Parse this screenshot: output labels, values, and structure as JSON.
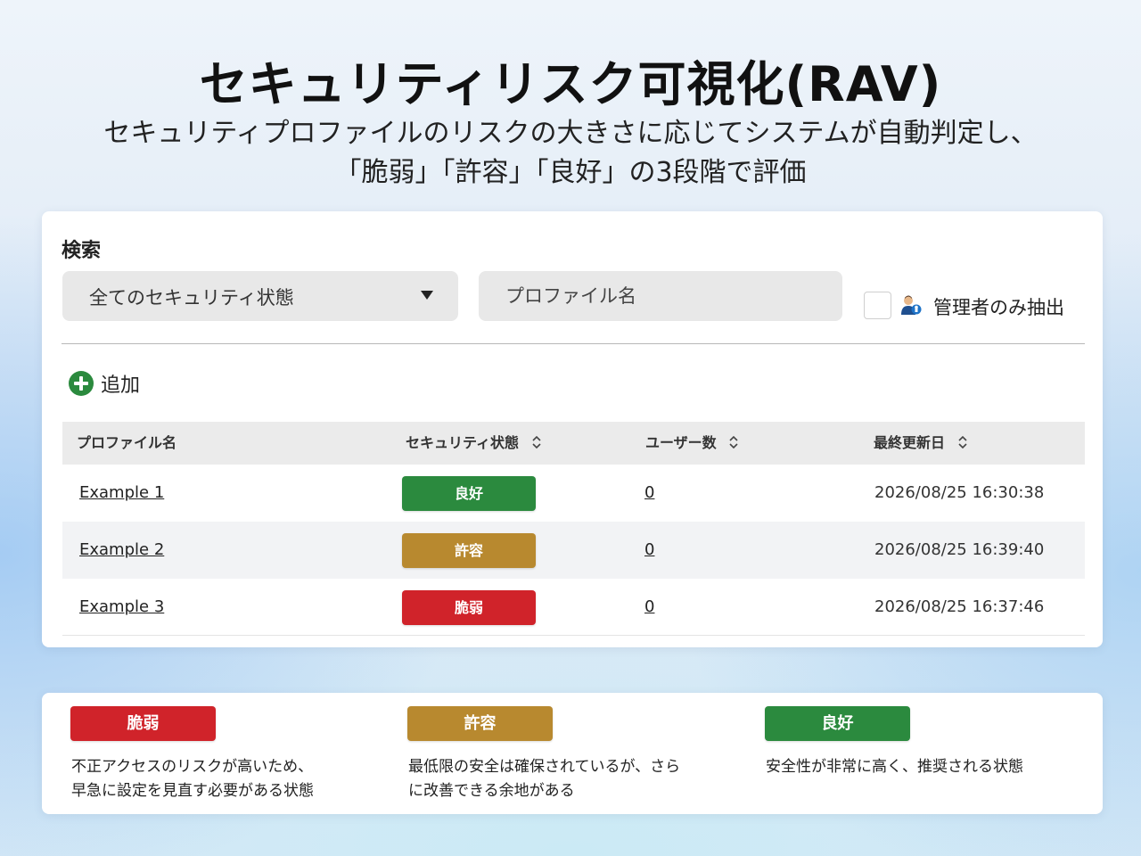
{
  "hero": {
    "title": "セキュリティリスク可視化(RAV)",
    "subtitle_line1": "セキュリティプロファイルのリスクの大きさに応じてシステムが自動判定し、",
    "subtitle_line2": "「脆弱」「許容」「良好」の3段階で評価"
  },
  "search": {
    "label": "検索",
    "status_select": "全てのセキュリティ状態",
    "profile_placeholder": "プロファイル名",
    "admin_only_label": "管理者のみ抽出",
    "admin_only_checked": false
  },
  "toolbar": {
    "add_label": "追加"
  },
  "table": {
    "headers": {
      "profile_name": "プロファイル名",
      "security_status": "セキュリティ状態",
      "user_count": "ユーザー数",
      "last_updated": "最終更新日"
    },
    "rows": [
      {
        "name": "Example 1",
        "status": "良好",
        "status_color": "#2b8a3e",
        "users": "0",
        "updated": "2026/08/25 16:30:38"
      },
      {
        "name": "Example 2",
        "status": "許容",
        "status_color": "#b8892f",
        "users": "0",
        "updated": "2026/08/25 16:39:40"
      },
      {
        "name": "Example 3",
        "status": "脆弱",
        "status_color": "#d0232a",
        "users": "0",
        "updated": "2026/08/25 16:37:46"
      }
    ]
  },
  "legend": [
    {
      "label": "脆弱",
      "color": "#d0232a",
      "desc_line1": "不正アクセスのリスクが高いため、",
      "desc_line2": "早急に設定を見直す必要がある状態"
    },
    {
      "label": "許容",
      "color": "#b8892f",
      "desc_line1": "最低限の安全は確保されているが、さら",
      "desc_line2": "に改善できる余地がある"
    },
    {
      "label": "良好",
      "color": "#2b8a3e",
      "desc_line1": "安全性が非常に高く、推奨される状態",
      "desc_line2": ""
    }
  ],
  "icons": {
    "admin": "admin-user-icon",
    "add": "plus-circle-icon",
    "sort": "sort-icon",
    "dropdown": "caret-down-icon"
  }
}
